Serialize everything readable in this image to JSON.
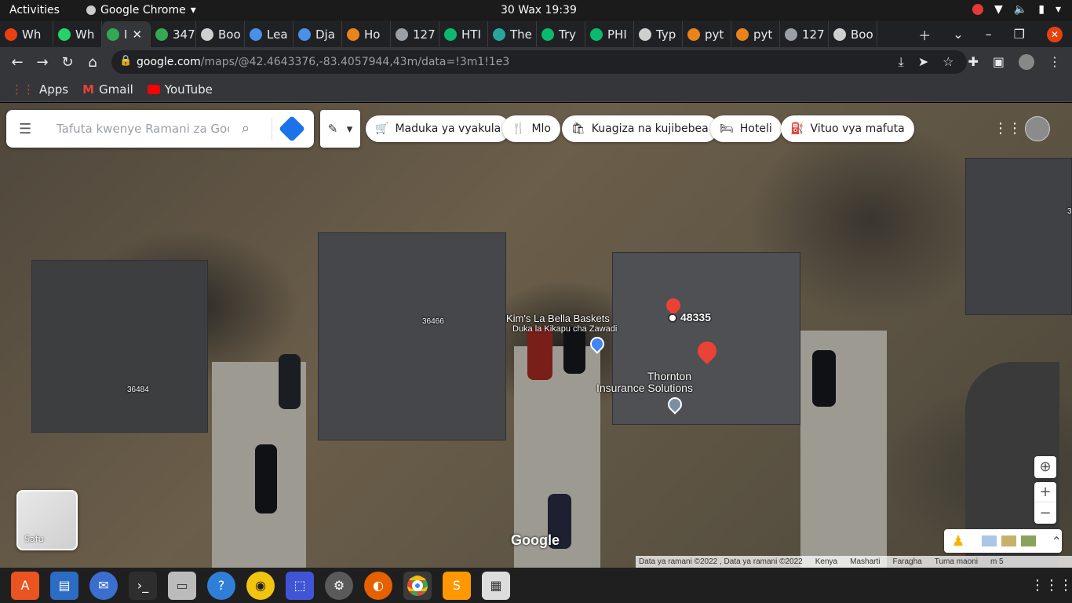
{
  "system": {
    "activities": "Activities",
    "app_name": "Google Chrome",
    "clock": "30 Wax  19:39"
  },
  "tabs": [
    {
      "label": "Wh",
      "color": "#e8410f"
    },
    {
      "label": "Wh",
      "color": "#25d366"
    },
    {
      "label": "I",
      "color": "#34a853",
      "active": true
    },
    {
      "label": "347",
      "color": "#34a853"
    },
    {
      "label": "Boo",
      "color": "#cfcfcf"
    },
    {
      "label": "Lea",
      "color": "#4a8fe8"
    },
    {
      "label": "Dja",
      "color": "#4a8fe8"
    },
    {
      "label": "Ho",
      "color": "#e8841a"
    },
    {
      "label": "127",
      "color": "#9aa0a6"
    },
    {
      "label": "HTI",
      "color": "#0cba6e"
    },
    {
      "label": "The",
      "color": "#27a6a0"
    },
    {
      "label": "Try",
      "color": "#0cba6e"
    },
    {
      "label": "PHI",
      "color": "#0cba6e"
    },
    {
      "label": "Typ",
      "color": "#cfcfcf"
    },
    {
      "label": "pyt",
      "color": "#e8841a"
    },
    {
      "label": "pyt",
      "color": "#e8841a"
    },
    {
      "label": "127",
      "color": "#9aa0a6"
    },
    {
      "label": "Boo",
      "color": "#cfcfcf"
    }
  ],
  "address": {
    "host": "google.com",
    "path": "/maps/@42.4643376,-83.4057944,43m/data=!3m1!1e3"
  },
  "bookmarks": [
    {
      "label": "Apps"
    },
    {
      "label": "Gmail"
    },
    {
      "label": "YouTube"
    }
  ],
  "search": {
    "placeholder": "Tafuta kwenye Ramani za Google"
  },
  "chips": [
    {
      "label": "Maduka ya vyakula",
      "icon": "cart-icon"
    },
    {
      "label": "Mlo",
      "icon": "fork-knife-icon"
    },
    {
      "label": "Kuagiza na kujibebea",
      "icon": "bag-icon"
    },
    {
      "label": "Hoteli",
      "icon": "bed-icon"
    },
    {
      "label": "Vituo vya mafuta",
      "icon": "fuel-icon"
    }
  ],
  "map_labels": {
    "kims_name": "Kim's La Bella Baskets",
    "kims_category": "Duka la Kikapu cha Zawadi",
    "zip": "48335",
    "thornton_line1": "Thornton",
    "thornton_line2": "Insurance Solutions",
    "house_36466": "36466",
    "house_36484": "36484",
    "edge_digit": "3"
  },
  "layers": {
    "label": "Safu"
  },
  "brand": "Google",
  "footer": {
    "data": "Data ya ramani ©2022 , Data ya ramani ©2022",
    "country": "Kenya",
    "terms": "Masharti",
    "privacy": "Faragha",
    "feedback": "Tuma maoni",
    "scale": "m 5"
  },
  "colors": {
    "pin_red": "#ea4335",
    "chrome_dark": "#202124",
    "maps_blue": "#1a73e8"
  }
}
